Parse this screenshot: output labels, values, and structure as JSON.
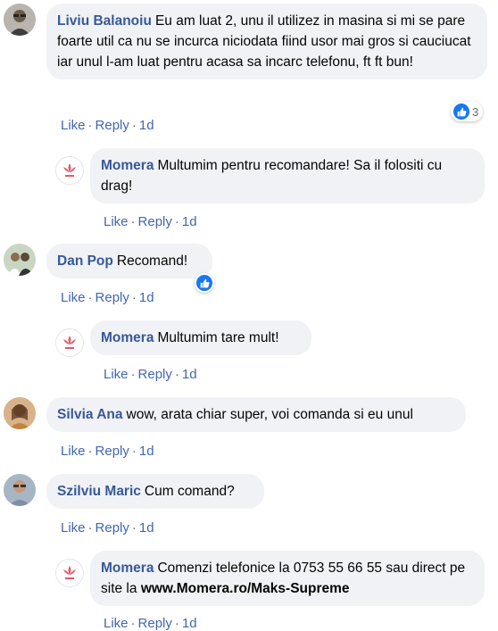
{
  "colors": {
    "bubble": "#f0f2f5",
    "author": "#385898",
    "action": "#4267b2",
    "like": "#1877f2"
  },
  "actions": {
    "like": "Like",
    "reply": "Reply",
    "sep": "·"
  },
  "comments": [
    {
      "author": "Liviu Balanoiu",
      "text": "Eu am luat 2, unu il utilizez in masina si mi se pare foarte util ca nu se incurca niciodata fiind usor mai gros si cauciucat iar unul l-am luat pentru acasa sa incarc telefonu, ft ft bun!",
      "time": "1d",
      "reactions": "3",
      "avatar": "man-glasses-avatar"
    },
    {
      "author": "Momera",
      "text": "Multumim pentru recomandare! Sa il folositi cu drag!",
      "time": "1d",
      "avatar": "momera-logo"
    },
    {
      "author": "Dan Pop",
      "text": "Recomand!",
      "time": "1d",
      "avatar": "wedding-photo-avatar"
    },
    {
      "author": "Momera",
      "text": "Multumim tare mult!",
      "time": "1d",
      "avatar": "momera-logo"
    },
    {
      "author": "Silvia Ana",
      "text": "wow, arata chiar super, voi comanda si eu unul",
      "time": "1d",
      "avatar": "woman-avatar"
    },
    {
      "author": "Szilviu Maric",
      "text": "Cum comand?",
      "time": "1d",
      "avatar": "man-avatar"
    },
    {
      "author": "Momera",
      "text": "Comenzi telefonice la 0753 55 66 55 sau direct pe site la",
      "link": "www.Momera.ro/Maks-Supreme",
      "time": "1d",
      "avatar": "momera-logo"
    }
  ]
}
